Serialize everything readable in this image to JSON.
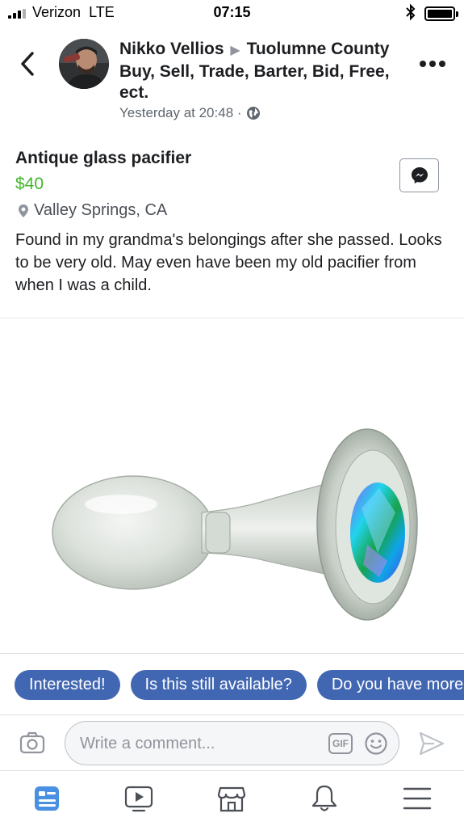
{
  "status_bar": {
    "carrier": "Verizon",
    "network": "LTE",
    "time": "07:15"
  },
  "post": {
    "author": "Nikko Vellios",
    "group": "Tuolumne County Buy, Sell, Trade, Barter, Bid, Free, ect.",
    "timestamp": "Yesterday at 20:48 ·",
    "privacy_icon": "globe-icon"
  },
  "listing": {
    "title": "Antique glass pacifier",
    "price": "$40",
    "location": "Valley Springs, CA",
    "description": "Found in my grandma's belongings after she passed. Looks to be very old.  May even have been my old pacifier from when I was a child."
  },
  "quick_replies": [
    "Interested!",
    "Is this still available?",
    "Do you have more info?"
  ],
  "comment": {
    "placeholder": "Write a comment...",
    "gif_label": "GIF"
  },
  "bottom_nav": [
    "news-feed",
    "watch",
    "marketplace",
    "notifications",
    "menu"
  ],
  "colors": {
    "accent": "#4267b2",
    "price": "#42b72a",
    "nav_active": "#4a90e2",
    "text": "#1c1e21",
    "secondary": "#606770"
  }
}
